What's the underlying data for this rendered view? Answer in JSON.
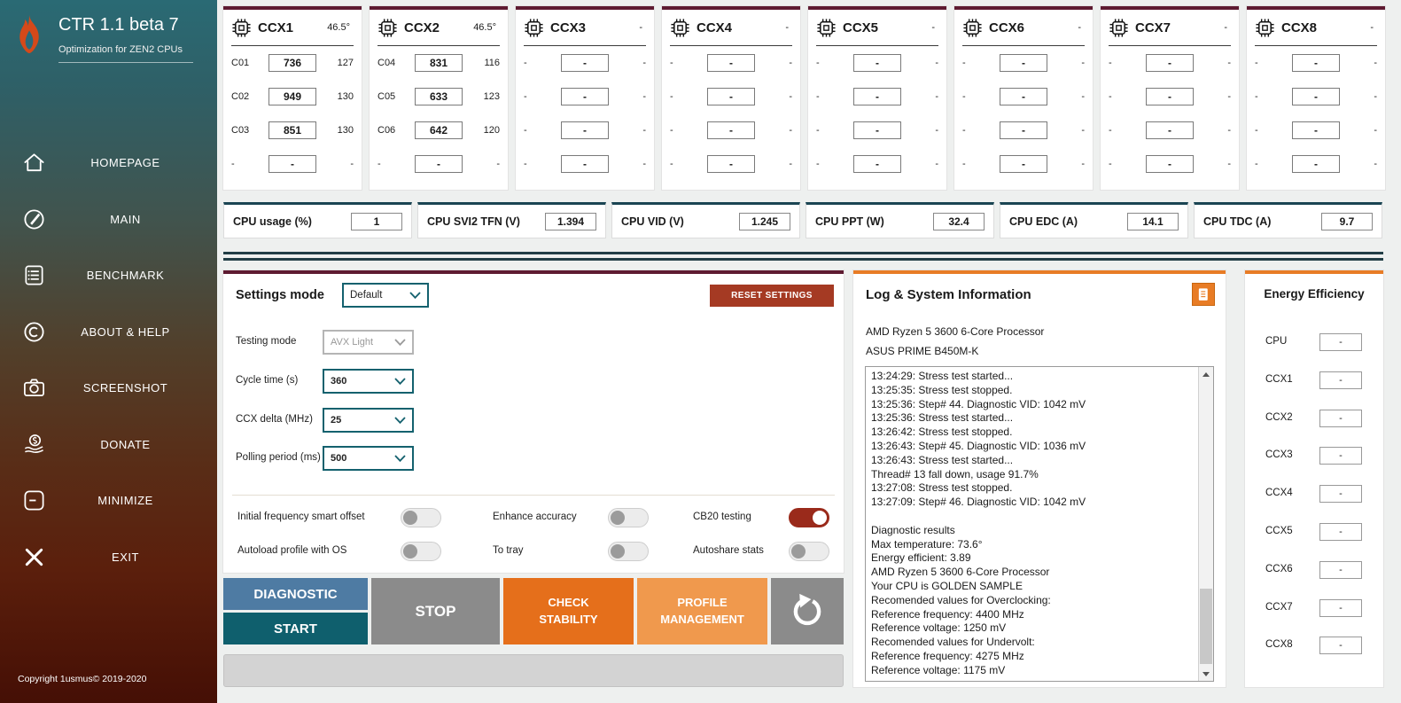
{
  "colors": {
    "accent_maroon": "#5e1b31",
    "accent_red": "#9a2a1b",
    "accent_teal": "#14616e",
    "accent_navy": "#1b4553",
    "accent_orange": "#e87c25",
    "accent_orange_light": "#f0994d",
    "accent_blue": "#4e7ba3"
  },
  "sidebar": {
    "title": "CTR 1.1 beta 7",
    "subtitle": "Optimization for ZEN2 CPUs",
    "copyright": "Copyright 1usmus© 2019-2020",
    "items": [
      {
        "label": "HOMEPAGE",
        "icon": "home-icon"
      },
      {
        "label": "MAIN",
        "icon": "gauge-icon"
      },
      {
        "label": "BENCHMARK",
        "icon": "benchmark-icon"
      },
      {
        "label": "ABOUT & HELP",
        "icon": "copyright-icon"
      },
      {
        "label": "SCREENSHOT",
        "icon": "camera-icon"
      },
      {
        "label": "DONATE",
        "icon": "donate-icon"
      },
      {
        "label": "MINIMIZE",
        "icon": "minimize-icon"
      },
      {
        "label": "EXIT",
        "icon": "exit-icon"
      }
    ]
  },
  "ccx_panels": [
    {
      "title": "CCX1",
      "temp": "46.5°",
      "rows": [
        [
          "C01",
          "736",
          "127"
        ],
        [
          "C02",
          "949",
          "130"
        ],
        [
          "C03",
          "851",
          "130"
        ],
        [
          "-",
          "-",
          "-"
        ]
      ]
    },
    {
      "title": "CCX2",
      "temp": "46.5°",
      "rows": [
        [
          "C04",
          "831",
          "116"
        ],
        [
          "C05",
          "633",
          "123"
        ],
        [
          "C06",
          "642",
          "120"
        ],
        [
          "-",
          "-",
          "-"
        ]
      ]
    },
    {
      "title": "CCX3",
      "temp": "-",
      "rows": [
        [
          "-",
          "-",
          "-"
        ],
        [
          "-",
          "-",
          "-"
        ],
        [
          "-",
          "-",
          "-"
        ],
        [
          "-",
          "-",
          "-"
        ]
      ]
    },
    {
      "title": "CCX4",
      "temp": "-",
      "rows": [
        [
          "-",
          "-",
          "-"
        ],
        [
          "-",
          "-",
          "-"
        ],
        [
          "-",
          "-",
          "-"
        ],
        [
          "-",
          "-",
          "-"
        ]
      ]
    },
    {
      "title": "CCX5",
      "temp": "-",
      "rows": [
        [
          "-",
          "-",
          "-"
        ],
        [
          "-",
          "-",
          "-"
        ],
        [
          "-",
          "-",
          "-"
        ],
        [
          "-",
          "-",
          "-"
        ]
      ]
    },
    {
      "title": "CCX6",
      "temp": "-",
      "rows": [
        [
          "-",
          "-",
          "-"
        ],
        [
          "-",
          "-",
          "-"
        ],
        [
          "-",
          "-",
          "-"
        ],
        [
          "-",
          "-",
          "-"
        ]
      ]
    },
    {
      "title": "CCX7",
      "temp": "-",
      "rows": [
        [
          "-",
          "-",
          "-"
        ],
        [
          "-",
          "-",
          "-"
        ],
        [
          "-",
          "-",
          "-"
        ],
        [
          "-",
          "-",
          "-"
        ]
      ]
    },
    {
      "title": "CCX8",
      "temp": "-",
      "rows": [
        [
          "-",
          "-",
          "-"
        ],
        [
          "-",
          "-",
          "-"
        ],
        [
          "-",
          "-",
          "-"
        ],
        [
          "-",
          "-",
          "-"
        ]
      ]
    }
  ],
  "cpu_stats": [
    {
      "label": "CPU usage (%)",
      "value": "1"
    },
    {
      "label": "CPU SVI2 TFN (V)",
      "value": "1.394"
    },
    {
      "label": "CPU VID (V)",
      "value": "1.245"
    },
    {
      "label": "CPU PPT (W)",
      "value": "32.4"
    },
    {
      "label": "CPU EDC (A)",
      "value": "14.1"
    },
    {
      "label": "CPU TDC (A)",
      "value": "9.7"
    }
  ],
  "settings": {
    "mode_label": "Settings mode",
    "mode_value": "Default",
    "reset_label": "RESET SETTINGS",
    "fields": [
      {
        "label": "Testing mode",
        "value": "AVX Light",
        "disabled": true
      },
      {
        "label": "Cycle time (s)",
        "value": "360",
        "disabled": false
      },
      {
        "label": "CCX delta (MHz)",
        "value": "25",
        "disabled": false
      },
      {
        "label": "Polling period (ms)",
        "value": "500",
        "disabled": false
      }
    ],
    "toggles": [
      {
        "label": "Initial frequency smart offset",
        "on": false
      },
      {
        "label": "Enhance accuracy",
        "on": false
      },
      {
        "label": "CB20 testing",
        "on": true
      },
      {
        "label": "Autoload profile with OS",
        "on": false
      },
      {
        "label": "To tray",
        "on": false
      },
      {
        "label": "Autoshare stats",
        "on": false
      }
    ]
  },
  "actions": {
    "diagnostic": "DIAGNOSTIC",
    "start": "START",
    "stop": "STOP",
    "check_stability": "CHECK STABILITY",
    "profile_management": "PROFILE MANAGEMENT"
  },
  "log": {
    "title": "Log & System Information",
    "cpu_name": "AMD Ryzen 5 3600 6-Core Processor",
    "motherboard": "ASUS PRIME B450M-K",
    "lines": [
      "13:24:29: Stress test started...",
      "13:25:35: Stress test stopped.",
      "13:25:36: Step# 44. Diagnostic VID: 1042 mV",
      "13:25:36: Stress test started...",
      "13:26:42: Stress test stopped.",
      "13:26:43: Step# 45. Diagnostic VID: 1036 mV",
      "13:26:43: Stress test started...",
      "Thread# 13 fall down, usage 91.7%",
      "13:27:08: Stress test stopped.",
      "13:27:09: Step# 46. Diagnostic VID: 1042 mV",
      "",
      "Diagnostic results",
      "Max temperature: 73.6°",
      "Energy efficient: 3.89",
      "AMD Ryzen 5 3600 6-Core Processor",
      "Your CPU is GOLDEN SAMPLE",
      "Recomended values for Overclocking:",
      "Reference frequency: 4400 MHz",
      "Reference voltage: 1250 mV",
      "Recomended values for Undervolt:",
      "Reference frequency: 4275 MHz",
      "Reference voltage: 1175 mV"
    ]
  },
  "energy": {
    "title": "Energy Efficiency",
    "rows": [
      {
        "label": "CPU",
        "value": "-"
      },
      {
        "label": "CCX1",
        "value": "-"
      },
      {
        "label": "CCX2",
        "value": "-"
      },
      {
        "label": "CCX3",
        "value": "-"
      },
      {
        "label": "CCX4",
        "value": "-"
      },
      {
        "label": "CCX5",
        "value": "-"
      },
      {
        "label": "CCX6",
        "value": "-"
      },
      {
        "label": "CCX7",
        "value": "-"
      },
      {
        "label": "CCX8",
        "value": "-"
      }
    ]
  }
}
